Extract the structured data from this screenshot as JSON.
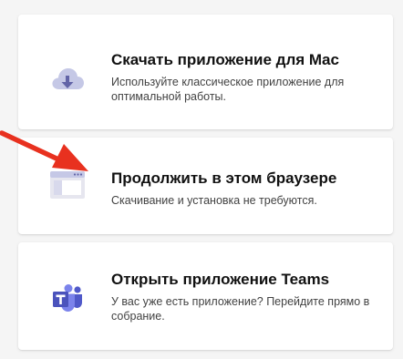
{
  "options": [
    {
      "title": "Скачать приложение для Mac",
      "description": "Используйте классическое приложение для оптимальной работы.",
      "icon": "cloud-download-icon"
    },
    {
      "title": "Продолжить в этом браузере",
      "description": "Скачивание и установка не требуются.",
      "icon": "browser-window-icon"
    },
    {
      "title": "Открыть приложение Teams",
      "description": "У вас уже есть приложение? Перейдите прямо в собрание.",
      "icon": "teams-logo-icon"
    }
  ],
  "colors": {
    "accent": "#6264a7",
    "arrow": "#e8311f",
    "card": "#ffffff",
    "background": "#f5f5f5"
  }
}
